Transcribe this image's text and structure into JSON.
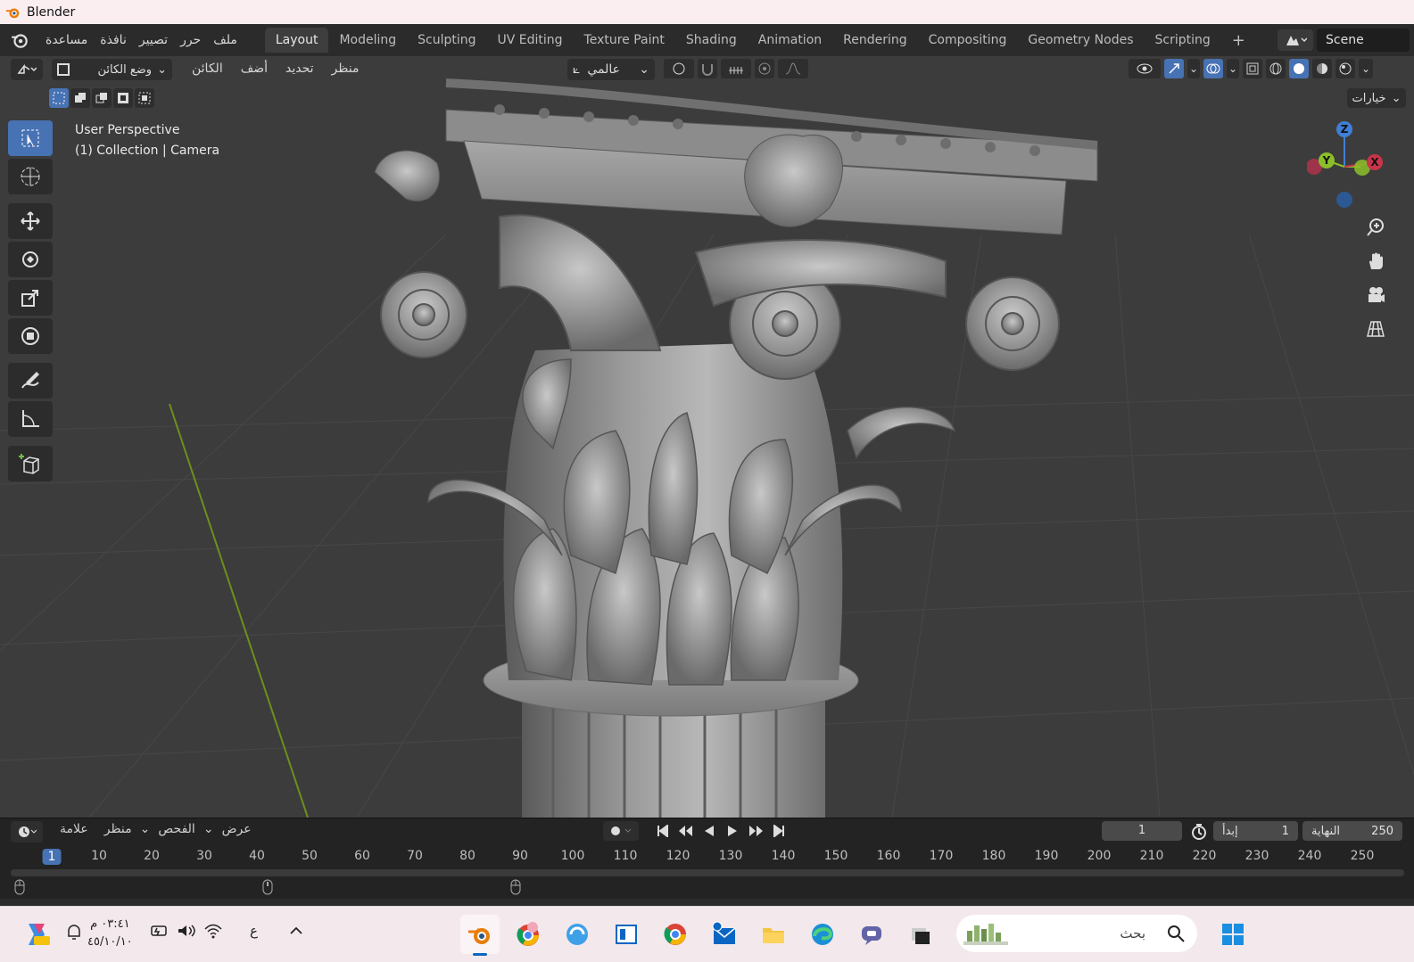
{
  "window": {
    "title": "Blender"
  },
  "topbar": {
    "menus": [
      "ملف",
      "حرر",
      "تصيير",
      "نافذة",
      "مساعدة"
    ],
    "tabs": [
      "Layout",
      "Modeling",
      "Sculpting",
      "UV Editing",
      "Texture Paint",
      "Shading",
      "Animation",
      "Rendering",
      "Compositing",
      "Geometry Nodes",
      "Scripting"
    ],
    "active_tab": "Layout",
    "add_tab": "+",
    "scene": "Scene"
  },
  "viewport": {
    "mode": "وضع الكائن",
    "menus": [
      "منظر",
      "تحديد",
      "أضف",
      "الكائن"
    ],
    "orientation": "عالمي",
    "options": "خيارات",
    "overlay_line1": "User Perspective",
    "overlay_line2": "(1) Collection | Camera",
    "gizmo": {
      "z": "Z",
      "y": "Y",
      "x": "X"
    }
  },
  "timeline": {
    "menus": [
      "عرض",
      "الفحص",
      "منظر",
      "علامة"
    ],
    "current_frame": "1",
    "start_label": "إبدأ",
    "start": "1",
    "end_label": "النهاية",
    "end": "250",
    "ticks": [
      "1",
      "10",
      "20",
      "30",
      "40",
      "50",
      "60",
      "70",
      "80",
      "90",
      "100",
      "110",
      "120",
      "130",
      "140",
      "150",
      "160",
      "170",
      "180",
      "190",
      "200",
      "210",
      "220",
      "230",
      "240",
      "250"
    ]
  },
  "taskbar": {
    "time": "٠٣:٤١ م",
    "date": "٤٥/١٠/١٠",
    "lang": "ع",
    "search_placeholder": "بحث"
  },
  "colors": {
    "accent": "#4772b3",
    "viewport_bg": "#3c3c3c",
    "panel_bg": "#2b2b2b"
  }
}
